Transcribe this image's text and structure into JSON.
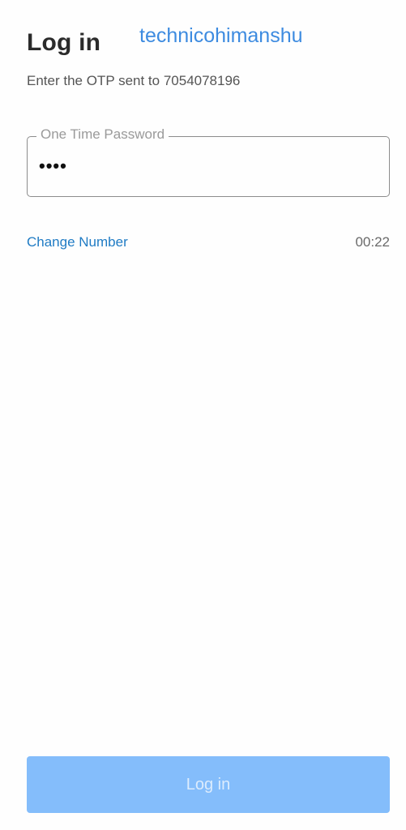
{
  "header": {
    "title": "Log in",
    "watermark": "technicohimanshu"
  },
  "otp": {
    "instruction": "Enter the OTP sent to 7054078196",
    "field_label": "One Time Password",
    "field_value": "••••"
  },
  "links": {
    "change_number": "Change Number",
    "timer": "00:22"
  },
  "footer": {
    "login_label": "Log in"
  },
  "colors": {
    "accent": "#1f7bc4",
    "button_disabled": "#84bdfb",
    "watermark": "#3d8be0"
  }
}
